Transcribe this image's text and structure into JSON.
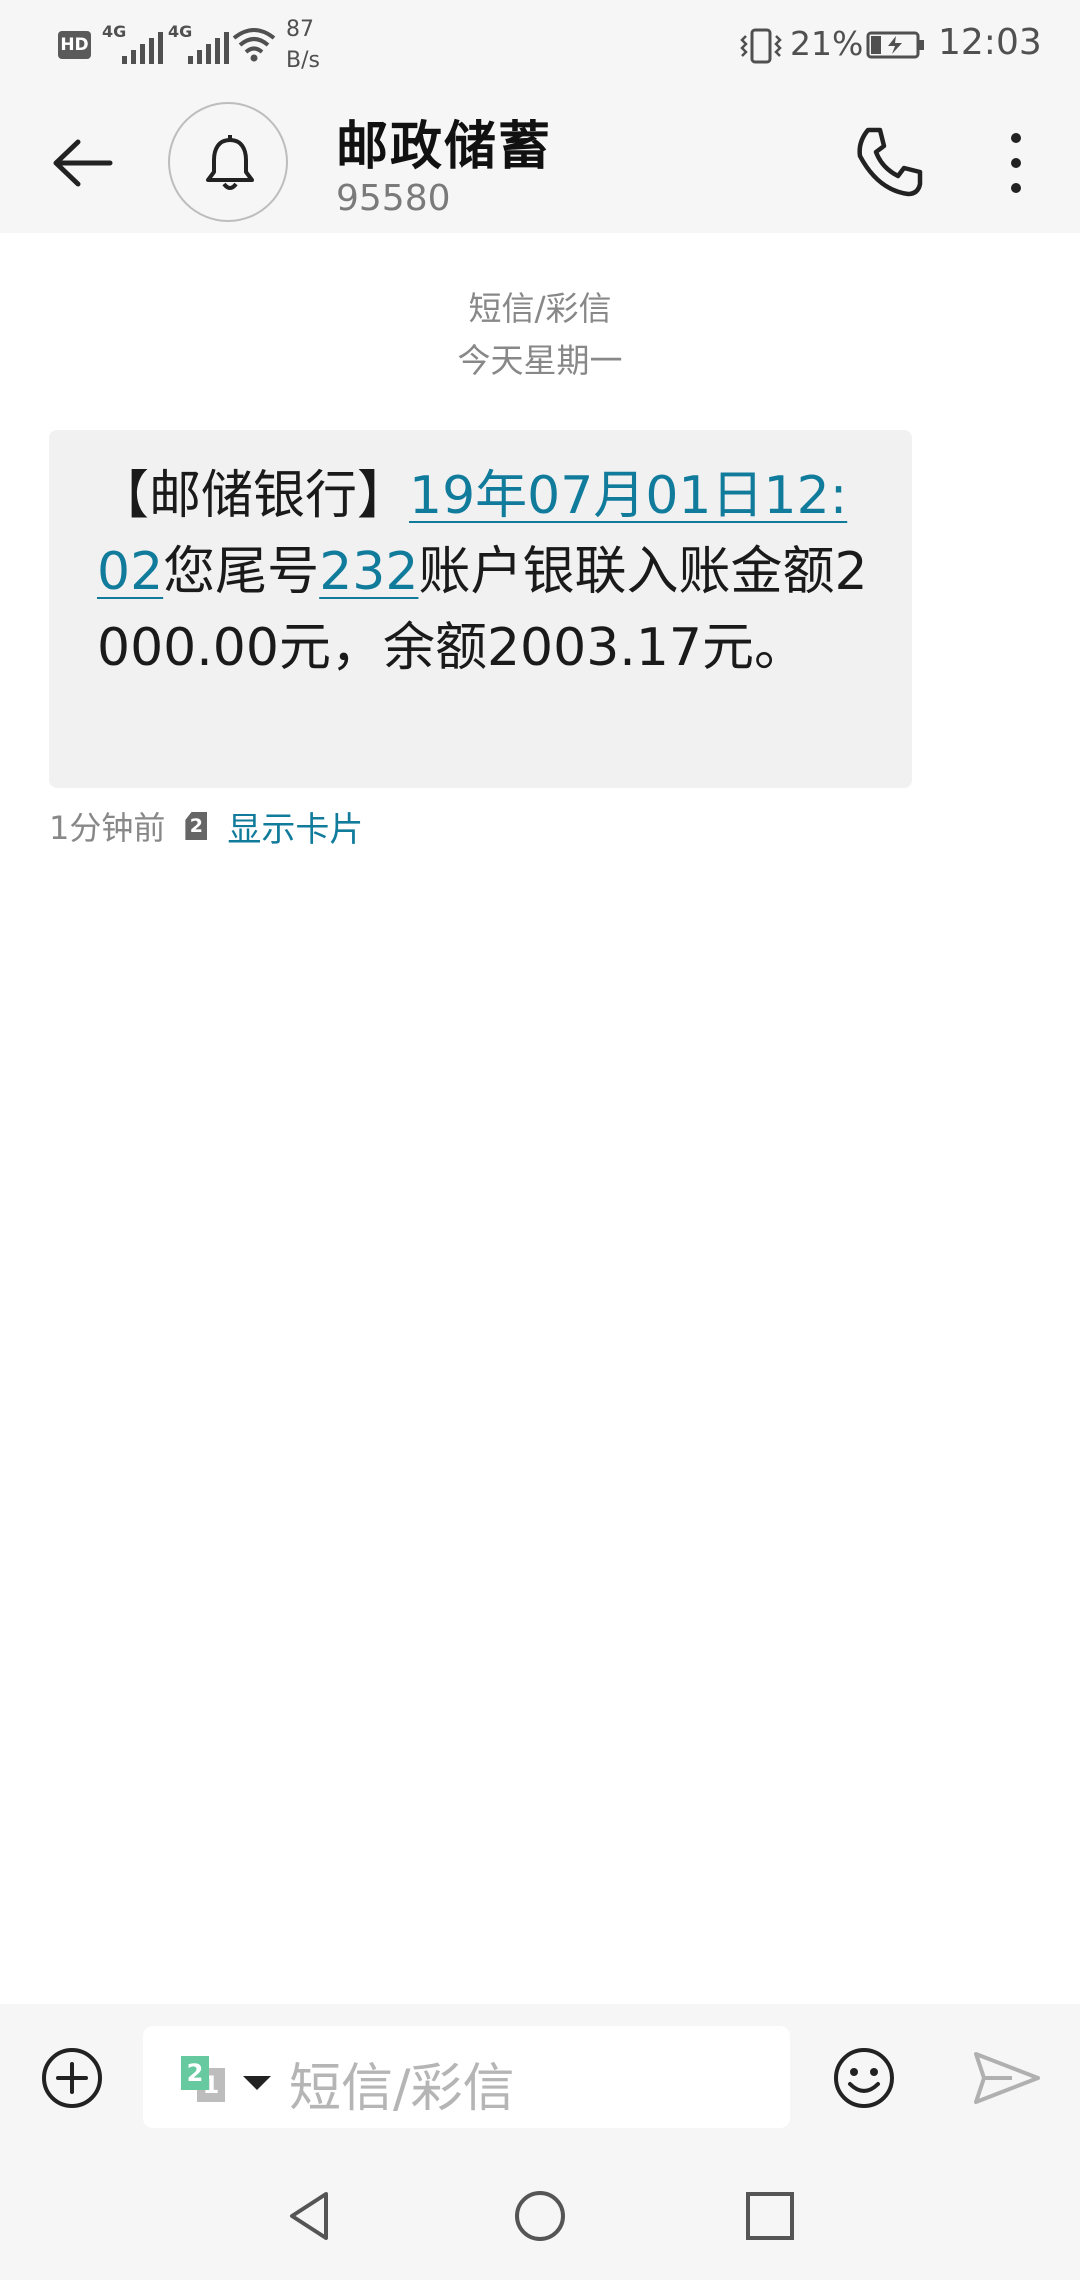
{
  "status_bar": {
    "hd": "HD",
    "network_1": "4G",
    "network_2": "4G",
    "speed_value": "87",
    "speed_unit": "B/s",
    "battery_percent": "21%",
    "time": "12:03"
  },
  "header": {
    "contact_name": "邮政储蓄",
    "contact_number": "95580"
  },
  "conversation": {
    "message_type": "短信/彩信",
    "date_label": "今天星期一",
    "message": {
      "part1": "【邮储银行】",
      "link1": "19年07月01日12:02",
      "part2": "您尾号",
      "link2": "232",
      "part3": "账户银联入账金额2000.00元，余额2003.17元。"
    },
    "time_ago": "1分钟前",
    "sim_number": "2",
    "show_card_label": "显示卡片"
  },
  "input_bar": {
    "sim_primary": "2",
    "sim_secondary": "1",
    "placeholder": "短信/彩信"
  },
  "colors": {
    "link": "#117b9c",
    "bubble": "#f1f1f1",
    "bar_background": "#f6f6f6"
  },
  "icons": [
    "back-arrow-icon",
    "bell-icon",
    "phone-icon",
    "more-vertical-icon",
    "add-circle-icon",
    "emoji-icon",
    "send-icon",
    "nav-back-icon",
    "nav-home-icon",
    "nav-recent-icon"
  ]
}
